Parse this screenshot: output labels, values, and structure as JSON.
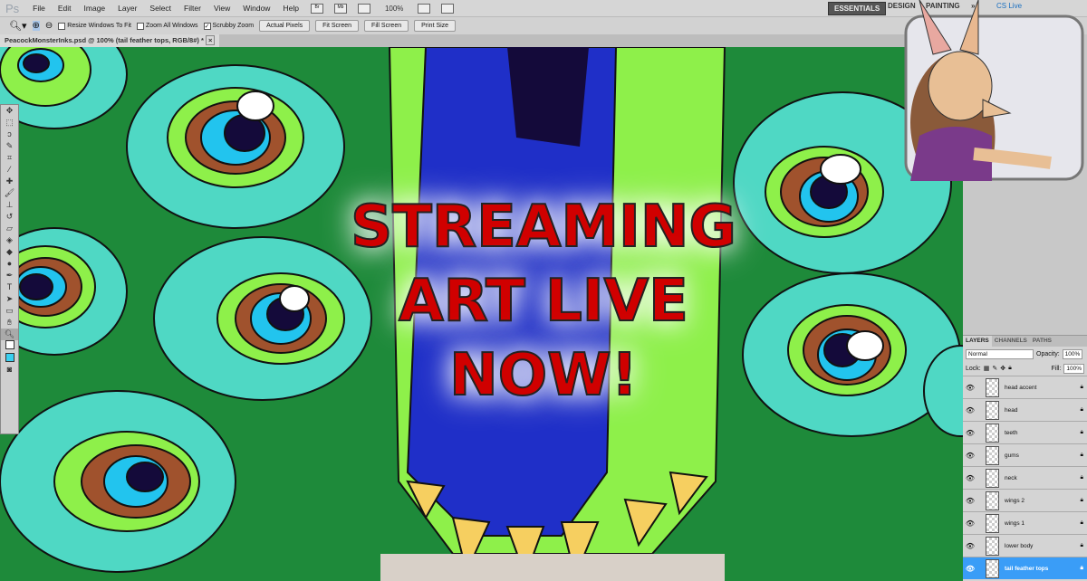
{
  "app": {
    "logo": "Ps",
    "menu": [
      "File",
      "Edit",
      "Image",
      "Layer",
      "Select",
      "Filter",
      "View",
      "Window",
      "Help"
    ],
    "bridge": "Br",
    "minibridge": "Mb",
    "zoom": "100%",
    "workspaces": [
      "ESSENTIALS",
      "DESIGN",
      "PAINTING"
    ],
    "more": "»",
    "cslive": "CS Live"
  },
  "options": {
    "resize_windows": "Resize Windows To Fit",
    "zoom_all": "Zoom All Windows",
    "scrubby": "Scrubby Zoom",
    "buttons": [
      "Actual Pixels",
      "Fit Screen",
      "Fill Screen",
      "Print Size"
    ]
  },
  "document": {
    "tab": "PeacockMonsterInks.psd @ 100% (tail feather tops, RGB/8#) *",
    "close": "×"
  },
  "overlay": {
    "line1": "STREAMING",
    "line2": "ART LIVE",
    "line3": "NOW!"
  },
  "layers": {
    "tabs": [
      "LAYERS",
      "CHANNELS",
      "PATHS"
    ],
    "blend": "Normal",
    "opacity_label": "Opacity:",
    "opacity": "100%",
    "lock_label": "Lock:",
    "fill_label": "Fill:",
    "fill": "100%",
    "items": [
      "head accent",
      "head",
      "teeth",
      "gums",
      "neck",
      "wings 2",
      "wings 1",
      "lower body",
      "tail feather tops"
    ]
  }
}
